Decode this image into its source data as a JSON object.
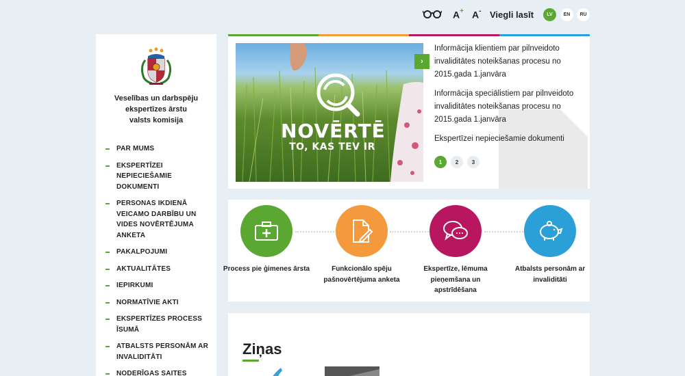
{
  "toolbar": {
    "glasses_icon": "glasses-icon",
    "font_increase": "A",
    "font_increase_sup": "+",
    "font_decrease": "A",
    "font_decrease_sup": "-",
    "easy_read": "Viegli lasīt",
    "languages": [
      "LV",
      "EN",
      "RU"
    ],
    "active_language": "LV"
  },
  "sidebar": {
    "org_name_line1": "Veselības un darbspēju",
    "org_name_line2": "ekspertīzes ārstu",
    "org_name_line3": "valsts komisija",
    "items": [
      "PAR MUMS",
      "EKSPERTĪZEI NEPIECIEŠAMIE DOKUMENTI",
      "PERSONAS IKDIENĀ VEICAMO DARBĪBU UN VIDES NOVĒRTĒJUMA ANKETA",
      "PAKALPOJUMI",
      "AKTUALITĀTES",
      "IEPIRKUMI",
      "NORMATĪVIE AKTI",
      "EKSPERTĪZES PROCESS ĪSUMĀ",
      "ATBALSTS PERSONĀM AR INVALIDITĀTI",
      "NODERĪGAS SAITES"
    ]
  },
  "slider": {
    "image_title": "NOVĒRTĒ",
    "image_subtitle": "TO, KAS TEV IR",
    "links": [
      "Informācija klientiem par pilnveidoto invaliditātes noteikšanas procesu no 2015.gada 1.janvāra",
      "Informācija speciālistiem par pilnveidoto invaliditātes noteikšanas procesu no 2015.gada 1.janvāra",
      "Ekspertīzei nepieciešamie dokumenti"
    ],
    "pages": [
      "1",
      "2",
      "3"
    ],
    "active_page": "1",
    "arrow": "›"
  },
  "steps": [
    {
      "label": "Process pie ģimenes ārsta",
      "color": "#5aa832",
      "icon": "medical-kit-icon"
    },
    {
      "label": "Funkcionālo spēju pašnovērtējuma anketa",
      "color": "#f59a3c",
      "icon": "document-pen-icon"
    },
    {
      "label": "Ekspertīze, lēmuma pieņemšana un apstrīdēšana",
      "color": "#b8175f",
      "icon": "speech-bubbles-icon"
    },
    {
      "label": "Atbalsts personām ar invaliditāti",
      "color": "#2a9fd8",
      "icon": "piggy-bank-icon"
    }
  ],
  "news": {
    "title": "Ziņas"
  },
  "colors": {
    "green": "#5aa832",
    "orange": "#f59a3c",
    "magenta": "#b8175f",
    "blue": "#2a9fd8",
    "background": "#e8eff4"
  }
}
